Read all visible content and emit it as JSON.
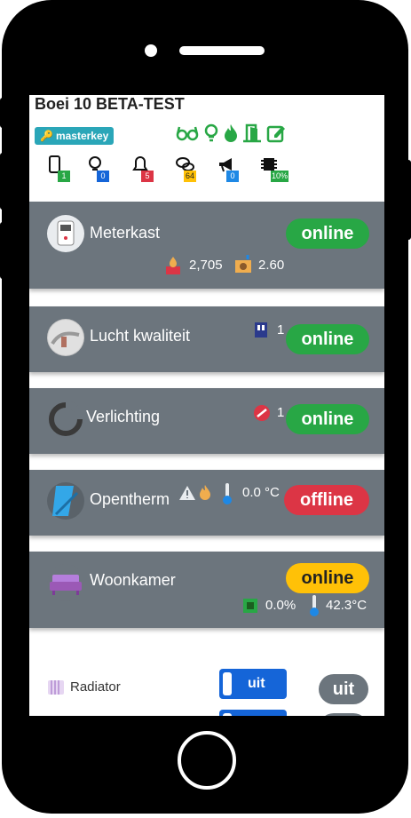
{
  "header": {
    "title": "Boei 10 BETA-TEST",
    "masterkey_label": "masterkey",
    "icons": [
      "glasses-icon",
      "bulb-icon",
      "flame-icon",
      "door-icon",
      "edit-icon"
    ]
  },
  "counters": [
    {
      "icon": "phone-icon",
      "value": "1",
      "color": "#28a745"
    },
    {
      "icon": "bulb-icon",
      "value": "0",
      "color": "#1565d8"
    },
    {
      "icon": "bell-icon",
      "value": "5",
      "color": "#dc3545"
    },
    {
      "icon": "chat-icon",
      "value": "64",
      "color": "#ffc107"
    },
    {
      "icon": "megaphone-icon",
      "value": "0",
      "color": "#1e88e5"
    },
    {
      "icon": "chip-icon",
      "value": "10%",
      "color": "#28a745"
    }
  ],
  "cards": {
    "meterkast": {
      "name": "Meterkast",
      "status": "online",
      "gas": "2,705",
      "power": "2.60"
    },
    "lucht": {
      "name": "Lucht kwaliteit",
      "status": "online",
      "count": "1"
    },
    "verlichting": {
      "name": "Verlichting",
      "status": "online",
      "count": "1"
    },
    "opentherm": {
      "name": "Opentherm",
      "status": "offline",
      "temp": "0.0 °C"
    },
    "woonkamer": {
      "name": "Woonkamer",
      "status": "online",
      "value": "0.0%",
      "temp": "42.3°C"
    }
  },
  "radiator": {
    "label": "Radiator",
    "toggle": "uit",
    "status": "uit"
  },
  "colors": {
    "online": "#28a745",
    "offline": "#dc3545",
    "warning": "#ffc107",
    "card": "#6c757d",
    "masterkey": "#2aa6b8"
  }
}
